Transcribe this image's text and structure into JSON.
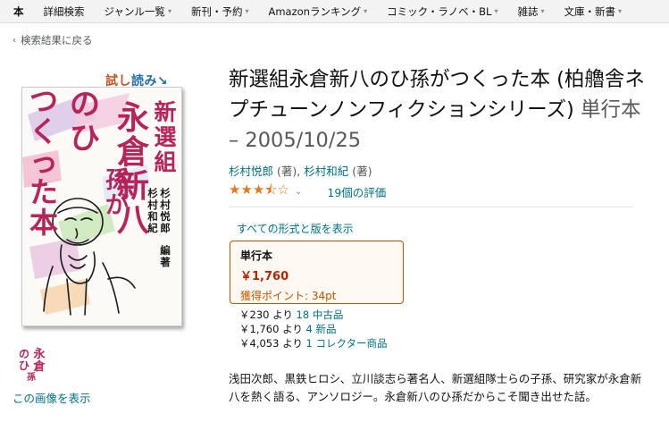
{
  "nav": {
    "items": [
      {
        "label": "本",
        "caret": false,
        "bold": true
      },
      {
        "label": "詳細検索",
        "caret": false,
        "bold": false
      },
      {
        "label": "ジャンル一覧",
        "caret": true,
        "bold": false
      },
      {
        "label": "新刊・予約",
        "caret": true,
        "bold": false
      },
      {
        "label": "Amazonランキング",
        "caret": true,
        "bold": false
      },
      {
        "label": "コミック・ラノベ・BL",
        "caret": true,
        "bold": false
      },
      {
        "label": "雑誌",
        "caret": true,
        "bold": false
      },
      {
        "label": "文庫・新書",
        "caret": true,
        "bold": false
      }
    ]
  },
  "back_link": "検索結果に戻る",
  "cover": {
    "sample_badge_a": "試し",
    "sample_badge_b": "読み",
    "title_col1": "新選組",
    "title_col2": "永倉新八",
    "title_col3": "のひ孫が",
    "title_col4": "つくった本",
    "editors_a": "杉村悦郎",
    "editors_b": "杉村和紀",
    "editors_role": "編著"
  },
  "thumbnail_text": "永倉のひ孫",
  "view_image_link": "この画像を表示",
  "product": {
    "title_main": "新選組永倉新八のひ孫がつくった本 (柏艪舎ネプチューンノンフィクションシリーズ)",
    "title_format": "単行本 – 2005/10/25",
    "author1": "杉村悦郎",
    "author1_role": "(著),",
    "author2": "杉村和紀",
    "author2_role": "(著)",
    "rating_stars": 3.5,
    "ratings_count": "19個の評価"
  },
  "formats": {
    "all_link": "すべての形式と版を表示",
    "selected": {
      "name": "単行本",
      "price": "￥1,760",
      "points": "獲得ポイント: 34pt"
    }
  },
  "offers": [
    {
      "price": "￥230 より",
      "link": "18 中古品"
    },
    {
      "price": "￥1,760 より",
      "link": "4 新品"
    },
    {
      "price": "￥4,053 より",
      "link": "1 コレクター商品"
    }
  ],
  "description": "浅田次郎、黒鉄ヒロシ、立川談志ら著名人、新選組隊士らの子孫、研究家が永倉新八を熱く語る、アンソロジー。永倉新八のひ孫だからこそ聞き出せた話。",
  "colors": {
    "accent_orange": "#c45500",
    "price_red": "#b12704",
    "link_teal": "#007185",
    "star": "#de7921",
    "cover_title_magenta": "#b8235a",
    "cover_title_dark": "#1a1a1a"
  }
}
